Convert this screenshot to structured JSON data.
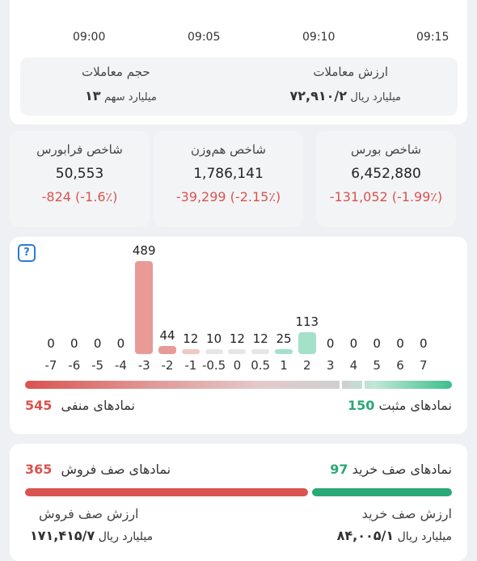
{
  "time_axis": {
    "ticks": [
      "09:00",
      "09:05",
      "09:10",
      "09:15"
    ]
  },
  "trades": {
    "value_title": "ارزش معاملات",
    "value_number": "۷۲,۹۱۰/۲",
    "value_unit": "میلیارد ریال",
    "volume_title": "حجم معاملات",
    "volume_number": "۱۳",
    "volume_unit": "میلیارد سهم"
  },
  "indices": [
    {
      "title": "شاخص بورس",
      "value": "6,452,880",
      "change": "-131,052 (-1.99٪)"
    },
    {
      "title": "شاخص هم‌وزن",
      "value": "1,786,141",
      "change": "-39,299 (-2.15٪)"
    },
    {
      "title": "شاخص فرابورس",
      "value": "50,553",
      "change": "-824 (-1.6٪)"
    }
  ],
  "colors": {
    "negative": "#d9534f",
    "positive": "#2aa876",
    "neg_bar": "#e89a97",
    "pos_bar": "#a5e0c8",
    "neutral_bar": "#e6e6e6"
  },
  "histogram": {
    "help_icon": "?",
    "chart_data": {
      "type": "bar",
      "categories": [
        "-7",
        "-6",
        "-5",
        "-4",
        "-3",
        "-2",
        "-1",
        "-0.5",
        "0",
        "0.5",
        "1",
        "2",
        "3",
        "4",
        "5",
        "6",
        "7"
      ],
      "values": [
        0,
        0,
        0,
        0,
        489,
        44,
        12,
        10,
        12,
        12,
        25,
        113,
        0,
        0,
        0,
        0,
        0
      ],
      "count_labels": [
        "0",
        "0",
        "0",
        "0",
        "489",
        "44",
        "12",
        "10",
        "12",
        "12",
        "25",
        "113",
        "0",
        "0",
        "0",
        "0",
        "0"
      ]
    },
    "negative_label": "نمادهای منفی",
    "negative_count": "545",
    "positive_label": "نمادهای مثبت",
    "positive_count": "150"
  },
  "queues": {
    "buy_label": "نمادهای صف خرید",
    "buy_count": "97",
    "sell_label": "نمادهای صف فروش",
    "sell_count": "365",
    "buy_value_title": "ارزش صف خرید",
    "buy_value_number": "۸۴,۰۰۵/۱",
    "buy_value_unit": "میلیارد ریال",
    "sell_value_title": "ارزش صف فروش",
    "sell_value_number": "۱۷۱,۴۱۵/۷",
    "sell_value_unit": "میلیارد ریال"
  }
}
